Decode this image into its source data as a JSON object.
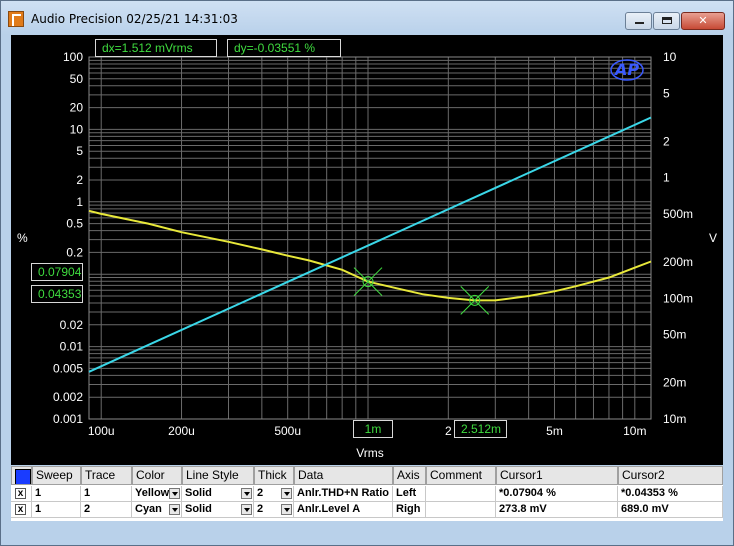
{
  "window": {
    "title": "Audio Precision  02/25/21 14:31:03",
    "buttons": {
      "minimize": "minimize",
      "maximize": "maximize",
      "close": "✕"
    }
  },
  "cursor_readouts": {
    "dx": "dx=1.512  mVrms",
    "dy": "dy=-0.03551  %",
    "left_cursor1": "0.07904",
    "left_cursor2": "0.04353",
    "x_cursor1": "1m",
    "x_cursor2": "2.512m",
    "x_cursor2_prefix": "2"
  },
  "colors": {
    "trace1": "#e8e83a",
    "trace2": "#3ad7e8",
    "cursor_text": "#3fdc3f",
    "background": "#000000",
    "grid": "#6a6a6a",
    "sweep_swatch": "#1a3cff"
  },
  "chart_data": {
    "type": "line",
    "xlabel": "Vrms",
    "ylabel_left": "%",
    "ylabel_right": "V",
    "x_scale": "log",
    "y_left_scale": "log",
    "y_right_scale": "log",
    "xlim": [
      9e-05,
      0.0115
    ],
    "ylim_left": [
      0.001,
      100
    ],
    "ylim_right": [
      0.01,
      10
    ],
    "x_ticks": [
      "100u",
      "200u",
      "500u",
      "2",
      "5m",
      "10m"
    ],
    "y_left_ticks": [
      "100",
      "50",
      "20",
      "10",
      "5",
      "2",
      "1",
      "0.5",
      "0.2",
      "0.1",
      "0.05",
      "0.02",
      "0.01",
      "0.005",
      "0.002",
      "0.001"
    ],
    "y_right_ticks": [
      "10",
      "5",
      "2",
      "1",
      "500m",
      "200m",
      "100m",
      "50m",
      "20m",
      "10m"
    ],
    "grid": true,
    "series": [
      {
        "name": "Anlr.THD+N Ratio",
        "axis": "left",
        "x": [
          9e-05,
          0.0001,
          0.00015,
          0.0002,
          0.0003,
          0.0004,
          0.0005,
          0.0006,
          0.0008,
          0.001,
          0.0013,
          0.0016,
          0.002,
          0.0025,
          0.003,
          0.004,
          0.005,
          0.006,
          0.008,
          0.0115
        ],
        "y": [
          0.75,
          0.68,
          0.5,
          0.38,
          0.28,
          0.22,
          0.18,
          0.155,
          0.115,
          0.079,
          0.063,
          0.053,
          0.047,
          0.0435,
          0.0435,
          0.05,
          0.058,
          0.068,
          0.09,
          0.15
        ]
      },
      {
        "name": "Anlr.Level A",
        "axis": "right",
        "x": [
          9e-05,
          0.0115
        ],
        "y": [
          0.0246,
          3.15
        ]
      }
    ],
    "cursors": [
      {
        "name": "Cursor1",
        "x": 0.001,
        "y_left": 0.07904
      },
      {
        "name": "Cursor2",
        "x": 0.002512,
        "y_left": 0.04353
      }
    ]
  },
  "table": {
    "headers": [
      "Sweep",
      "Trace",
      "Color",
      "Line Style",
      "Thick",
      "Data",
      "Axis",
      "Comment",
      "Cursor1",
      "Cursor2"
    ],
    "rows": [
      {
        "check": "x",
        "sweep": "1",
        "trace": "1",
        "color": "Yellow",
        "style": "Solid",
        "thick": "2",
        "data": "Anlr.THD+N Ratio",
        "axis": "Left",
        "comment": "",
        "cursor1": "*0.07904  %",
        "cursor2": "*0.04353  %"
      },
      {
        "check": "x",
        "sweep": "1",
        "trace": "2",
        "color": "Cyan",
        "style": "Solid",
        "thick": "2",
        "data": "Anlr.Level A",
        "axis": "Righ",
        "comment": "",
        "cursor1": "273.8   mV",
        "cursor2": "689.0   mV"
      }
    ]
  }
}
